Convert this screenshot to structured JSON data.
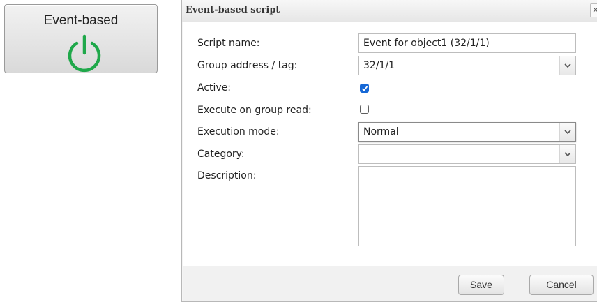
{
  "tile": {
    "label": "Event-based",
    "icon": "power-icon",
    "accent": "#1fa84a"
  },
  "dialog": {
    "title": "Event-based script",
    "close_glyph": "×",
    "fields": {
      "script_name": {
        "label": "Script name:",
        "value": "Event for object1 (32/1/1)"
      },
      "group_address": {
        "label": "Group address / tag:",
        "value": "32/1/1"
      },
      "active": {
        "label": "Active:",
        "checked": true
      },
      "execute_on_read": {
        "label": "Execute on group read:",
        "checked": false
      },
      "execution_mode": {
        "label": "Execution mode:",
        "value": "Normal"
      },
      "category": {
        "label": "Category:",
        "value": ""
      },
      "description": {
        "label": "Description:",
        "value": ""
      }
    },
    "buttons": {
      "save": "Save",
      "cancel": "Cancel"
    }
  },
  "colors": {
    "checkbox_checked": "#1668d6"
  }
}
